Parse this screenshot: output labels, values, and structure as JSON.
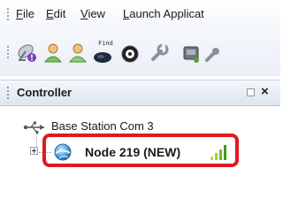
{
  "menu": {
    "items": [
      "File",
      "Edit",
      "View",
      "Launch Applicat"
    ],
    "mnemonics": [
      "F",
      "E",
      "V",
      "L"
    ]
  },
  "toolbar": {
    "icons": [
      "satellite-dish-icon",
      "user-icon",
      "user-icon",
      "find-icon",
      "record-icon",
      "wrench-icon",
      "device-icon",
      "tool-icon"
    ],
    "find_label": "Find"
  },
  "panel": {
    "title": "Controller"
  },
  "tree": {
    "root_label": "Base Station Com 3",
    "node_label": "Node 219 (NEW)"
  },
  "colors": {
    "highlight": "#e0191f",
    "signal": "#4caf1e"
  }
}
